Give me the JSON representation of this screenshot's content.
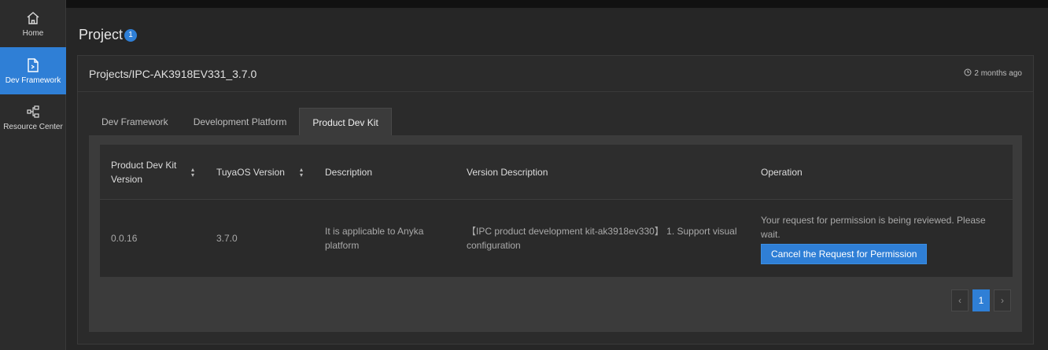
{
  "sidebar": {
    "items": [
      {
        "label": "Home",
        "icon": "home-icon"
      },
      {
        "label": "Dev Framework",
        "icon": "document-icon",
        "active": true
      },
      {
        "label": "Resource Center",
        "icon": "resource-tree-icon"
      }
    ]
  },
  "page": {
    "title": "Project",
    "count": "1"
  },
  "project": {
    "title": "Projects/IPC-AK3918EV331_3.7.0",
    "updated": "2 months ago"
  },
  "tabs": [
    {
      "label": "Dev Framework"
    },
    {
      "label": "Development Platform"
    },
    {
      "label": "Product Dev Kit",
      "active": true
    }
  ],
  "table": {
    "headers": {
      "kit_version": "Product Dev Kit Version",
      "tuyaos_version": "TuyaOS Version",
      "description": "Description",
      "version_description": "Version Description",
      "operation": "Operation"
    },
    "rows": [
      {
        "kit_version": "0.0.16",
        "tuyaos_version": "3.7.0",
        "description": "It is applicable to Anyka platform",
        "version_description": "【IPC product development kit-ak3918ev330】 1. Support visual configuration",
        "operation_status": "Your request for permission is being reviewed. Please wait.",
        "operation_button": "Cancel the Request for Permission"
      }
    ]
  },
  "pagination": {
    "prev": "‹",
    "current": "1",
    "next": "›"
  },
  "colors": {
    "accent": "#2f7fd6",
    "background": "#262626"
  }
}
